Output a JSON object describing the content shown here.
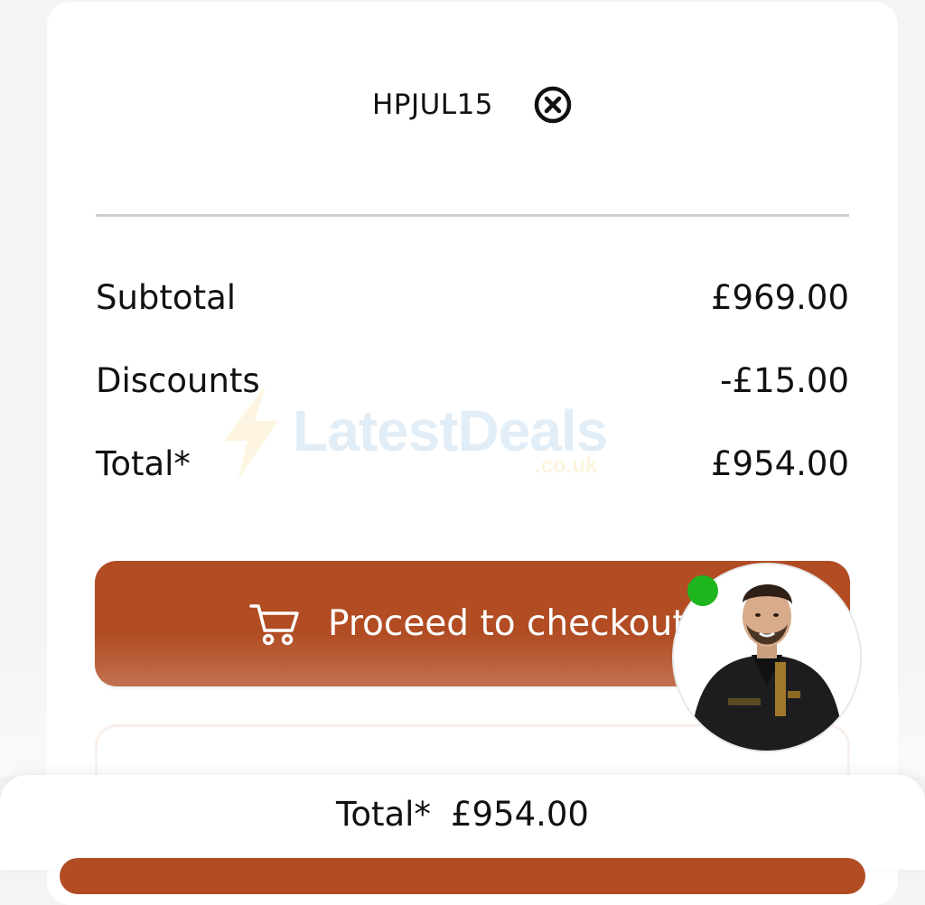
{
  "coupon": {
    "code": "HPJUL15",
    "remove_icon": "close-circle-icon"
  },
  "summary": {
    "subtotal_label": "Subtotal",
    "subtotal_value": "£969.00",
    "discounts_label": "Discounts",
    "discounts_value": "-£15.00",
    "total_label": "Total*",
    "total_value": "£954.00"
  },
  "checkout": {
    "label": "Proceed to checkout",
    "icon": "shopping-cart-icon",
    "color": "#b14c23"
  },
  "assistant": {
    "status_color": "#1fb51f",
    "status": "online"
  },
  "watermark": {
    "brand": "LatestDeals",
    "domain": ".co.uk"
  },
  "sticky_footer": {
    "total_label": "Total*",
    "total_value": "£954.00"
  }
}
